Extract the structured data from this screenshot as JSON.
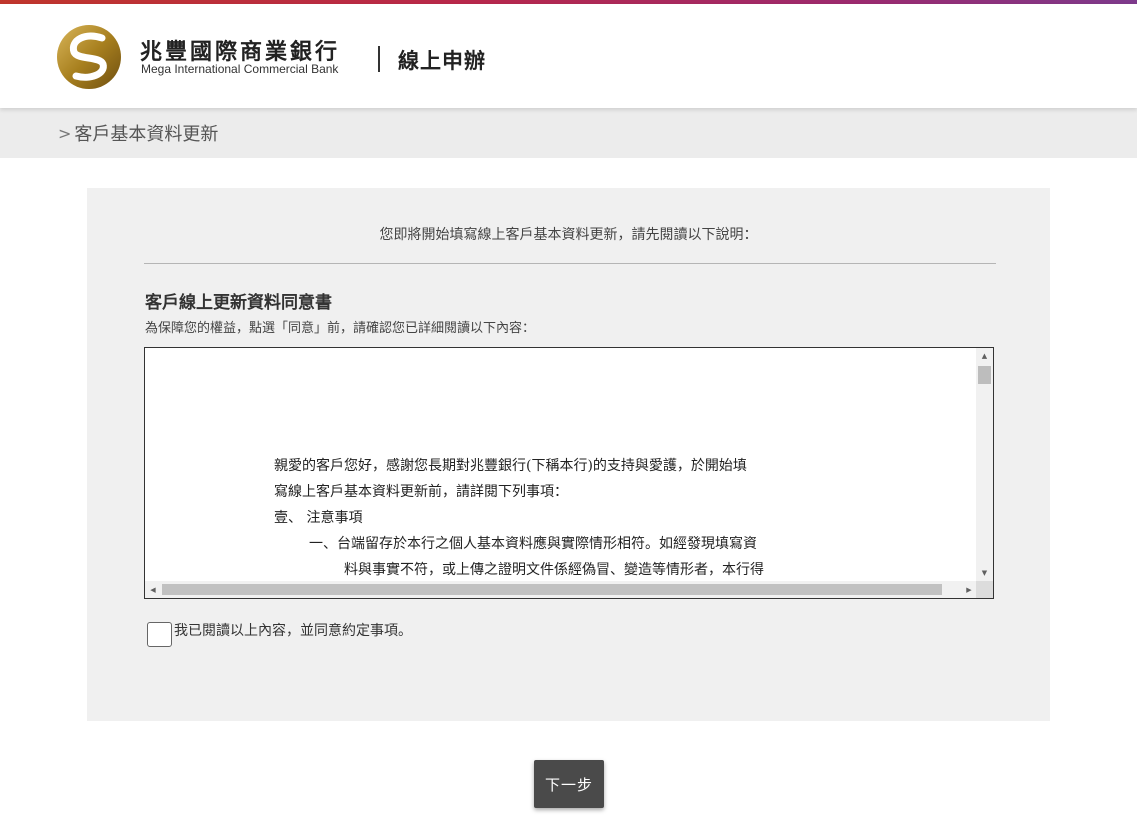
{
  "header": {
    "bank_name_zh": "兆豐國際商業銀行",
    "bank_name_en": "Mega International Commercial Bank",
    "service_title": "線上申辦",
    "logo_icon": "mega-bank-logo-icon",
    "brand_colors": {
      "gold": "#b08a2e",
      "top_bar_start": "#c0362c",
      "top_bar_end": "#7d3a8c"
    }
  },
  "breadcrumb": {
    "chevron": ">",
    "current": "客戶基本資料更新"
  },
  "main": {
    "intro": "您即將開始填寫線上客戶基本資料更新，請先閱讀以下說明：",
    "consent_title": "客戶線上更新資料同意書",
    "consent_subtitle": "為保障您的權益，點選「同意」前，請確認您已詳細閱讀以下內容：",
    "document_lines": [
      "親愛的客戶您好，感謝您長期對兆豐銀行(下稱本行)的支持與愛護，於開始填",
      "寫線上客戶基本資料更新前，請詳閱下列事項：",
      "壹、 注意事項",
      "一、台端留存於本行之個人基本資料應與實際情形相符。如經發現填寫資",
      "料與事實不符，或上傳之證明文件係經偽冒、變造等情形者，本行得"
    ],
    "agree_label": "我已閱讀以上內容，並同意約定事項。",
    "agree_checked": false
  },
  "footer": {
    "next_button": "下一步"
  }
}
